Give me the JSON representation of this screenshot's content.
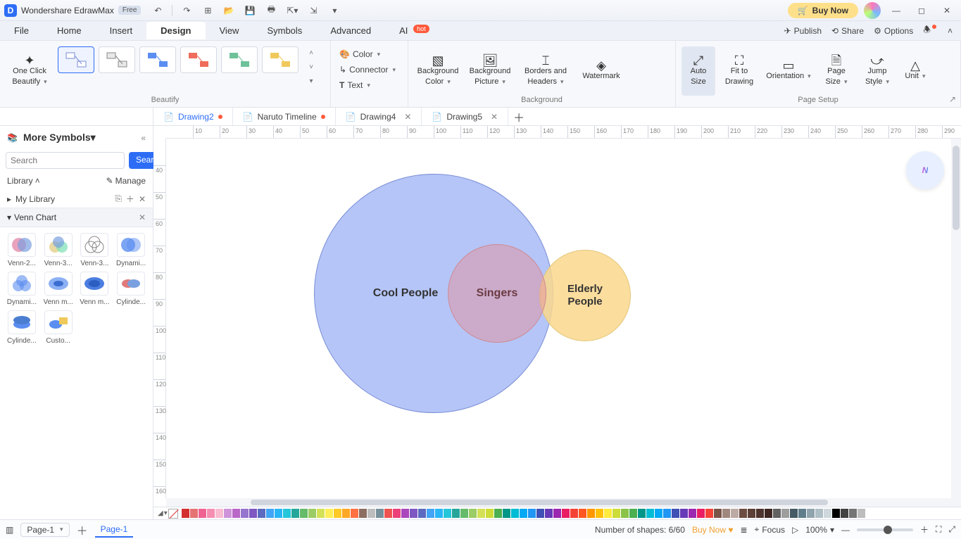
{
  "titlebar": {
    "app_name": "Wondershare EdrawMax",
    "free_badge": "Free",
    "buy_now": "Buy Now"
  },
  "menubar": {
    "items": [
      "File",
      "Home",
      "Insert",
      "Design",
      "View",
      "Symbols",
      "Advanced"
    ],
    "ai_label": "AI",
    "hot_label": "hot",
    "publish": "Publish",
    "share": "Share",
    "options": "Options"
  },
  "ribbon": {
    "oneclick_line1": "One Click",
    "oneclick_line2": "Beautify",
    "beautify_title": "Beautify",
    "color": "Color",
    "connector": "Connector",
    "text": "Text",
    "background_color_line1": "Background",
    "background_color_line2": "Color",
    "background_picture_line1": "Background",
    "background_picture_line2": "Picture",
    "borders_line1": "Borders and",
    "borders_line2": "Headers",
    "watermark": "Watermark",
    "background_title": "Background",
    "auto_line1": "Auto",
    "auto_line2": "Size",
    "fit_line1": "Fit to",
    "fit_line2": "Drawing",
    "orientation": "Orientation",
    "page_line1": "Page",
    "page_line2": "Size",
    "jump_line1": "Jump",
    "jump_line2": "Style",
    "unit": "Unit",
    "pagesetup_title": "Page Setup"
  },
  "tabs": [
    {
      "name": "Drawing2",
      "modified": true
    },
    {
      "name": "Naruto Timeline",
      "modified": true
    },
    {
      "name": "Drawing4",
      "modified": false
    },
    {
      "name": "Drawing5",
      "modified": false
    }
  ],
  "sidebar": {
    "more_symbols": "More Symbols",
    "search_placeholder": "Search",
    "search_btn": "Search",
    "library": "Library",
    "manage": "Manage",
    "my_library": "My Library",
    "section": "Venn Chart",
    "shapes": [
      "Venn-2...",
      "Venn-3...",
      "Venn-3...",
      "Dynami...",
      "Dynami...",
      "Venn m...",
      "Venn m...",
      "Cylinde...",
      "Cylinde...",
      "Custo..."
    ]
  },
  "ruler_h": [
    10,
    20,
    30,
    40,
    50,
    60,
    70,
    80,
    90,
    100,
    110,
    120,
    130,
    140,
    150,
    160,
    170,
    180,
    190,
    200,
    210,
    220,
    230,
    240,
    250,
    260,
    270,
    280,
    290
  ],
  "ruler_v": [
    40,
    50,
    60,
    70,
    80,
    90,
    100,
    110,
    120,
    130,
    140,
    150,
    160
  ],
  "venn": {
    "cool": "Cool People",
    "singers": "Singers",
    "elderly_line1": "Elderly",
    "elderly_line2": "People"
  },
  "status": {
    "page_sel": "Page-1",
    "page_tab": "Page-1",
    "shape_count": "Number of shapes: 6/60",
    "buy_now": "Buy Now",
    "focus": "Focus",
    "zoom": "100%"
  },
  "color_palette": [
    "#d32f2f",
    "#e57373",
    "#f06292",
    "#f48fb1",
    "#f8bbd0",
    "#ce93d8",
    "#ba68c8",
    "#9575cd",
    "#7e57c2",
    "#5c6bc0",
    "#42a5f5",
    "#29b6f6",
    "#26c6da",
    "#26a69a",
    "#66bb6a",
    "#9ccc65",
    "#d4e157",
    "#ffee58",
    "#ffca28",
    "#ffa726",
    "#ff7043",
    "#8d6e63",
    "#bdbdbd",
    "#78909c",
    "#ef5350",
    "#ec407a",
    "#ab47bc",
    "#7e57c2",
    "#5c6bc0",
    "#42a5f5",
    "#29b6f6",
    "#26c6da",
    "#26a69a",
    "#66bb6a",
    "#9ccc65",
    "#d4e157",
    "#cddc39",
    "#4caf50",
    "#009688",
    "#00bcd4",
    "#03a9f4",
    "#2196f3",
    "#3f51b5",
    "#673ab7",
    "#9c27b0",
    "#e91e63",
    "#f44336",
    "#ff5722",
    "#ff9800",
    "#ffc107",
    "#ffeb3b",
    "#cddc39",
    "#8bc34a",
    "#4caf50",
    "#009688",
    "#00bcd4",
    "#03a9f4",
    "#2196f3",
    "#3f51b5",
    "#673ab7",
    "#9c27b0",
    "#e91e63",
    "#f44336",
    "#795548",
    "#a1887f",
    "#bcaaa4",
    "#6d4c41",
    "#5d4037",
    "#4e342e",
    "#3e2723",
    "#616161",
    "#9e9e9e",
    "#455a64",
    "#607d8b",
    "#90a4ae",
    "#b0bec5",
    "#cfd8dc",
    "#000000",
    "#424242",
    "#757575",
    "#bdbdbd",
    "#ffffff"
  ]
}
